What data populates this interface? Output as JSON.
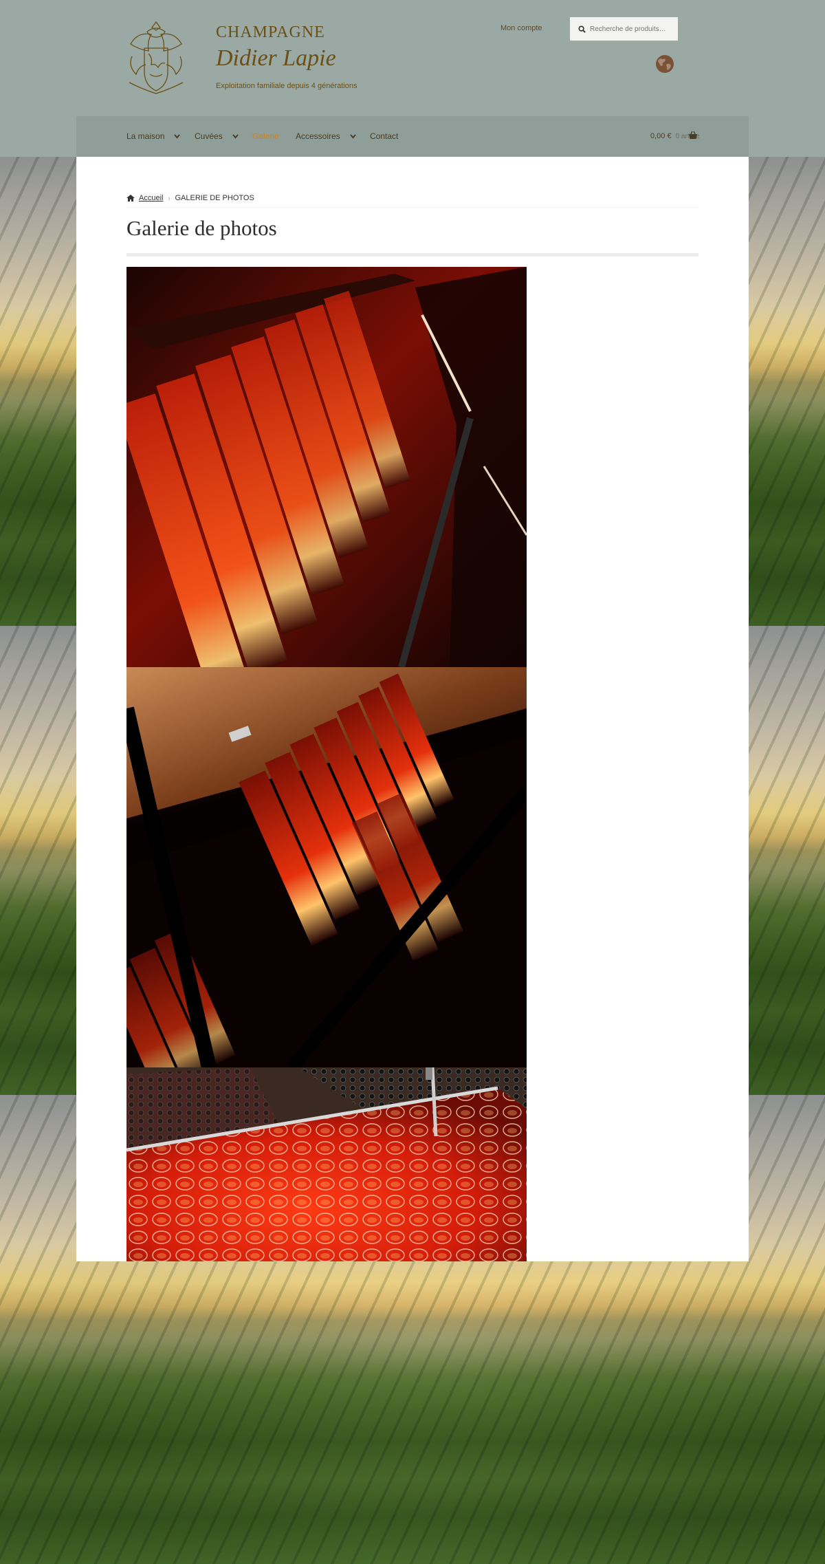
{
  "header": {
    "brand_line1": "CHAMPAGNE",
    "brand_line2": "Didier Lapie",
    "tagline": "Exploitation familiale depuis 4 générations",
    "account_link": "Mon compte",
    "search_placeholder": "Recherche de produits…",
    "accent_color": "#6b4f16",
    "background_color": "#9aa9a3"
  },
  "nav": {
    "items": [
      {
        "label": "La maison",
        "has_dropdown": true
      },
      {
        "label": "Cuvées",
        "has_dropdown": true
      },
      {
        "label": "Galerie",
        "has_dropdown": false,
        "active": true
      },
      {
        "label": "Accessoires",
        "has_dropdown": true
      },
      {
        "label": "Contact",
        "has_dropdown": false
      }
    ],
    "active_color": "#c7842a",
    "cart": {
      "amount": "0,00 €",
      "count": "0 article",
      "icon": "basket-icon"
    }
  },
  "breadcrumb": {
    "home": "Accueil",
    "current": "GALERIE DE PHOTOS"
  },
  "page": {
    "title": "Galerie de photos"
  },
  "gallery": [
    {
      "name": "rose-champagne-bottles-riddling-rack-1"
    },
    {
      "name": "rose-champagne-bottles-riddling-rack-2"
    },
    {
      "name": "illuminated-champagne-glasses-tray"
    }
  ]
}
